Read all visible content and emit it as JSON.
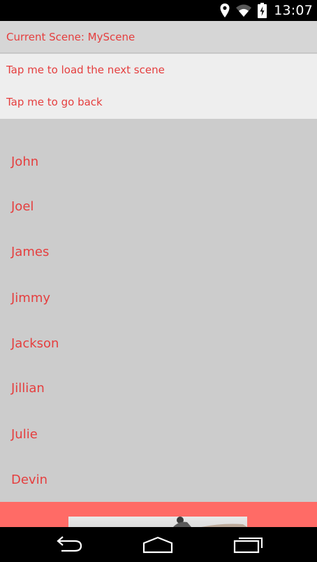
{
  "status_bar": {
    "time": "13:07",
    "icons": [
      "location-pin-icon",
      "wifi-icon",
      "battery-charging-icon"
    ]
  },
  "scene": {
    "current_label": "Current Scene: MyScene"
  },
  "navigation": {
    "next_label": "Tap me to load the next scene",
    "back_label": "Tap me to go back"
  },
  "names": [
    "John",
    "Joel",
    "James",
    "Jimmy",
    "Jackson",
    "Jillian",
    "Julie",
    "Devin"
  ],
  "system_nav": {
    "icons": [
      "back-icon",
      "home-icon",
      "recent-apps-icon"
    ]
  },
  "colors": {
    "accent_text": "#e53e3e",
    "footer_band": "#ff6b66",
    "background": "#cccccc"
  }
}
